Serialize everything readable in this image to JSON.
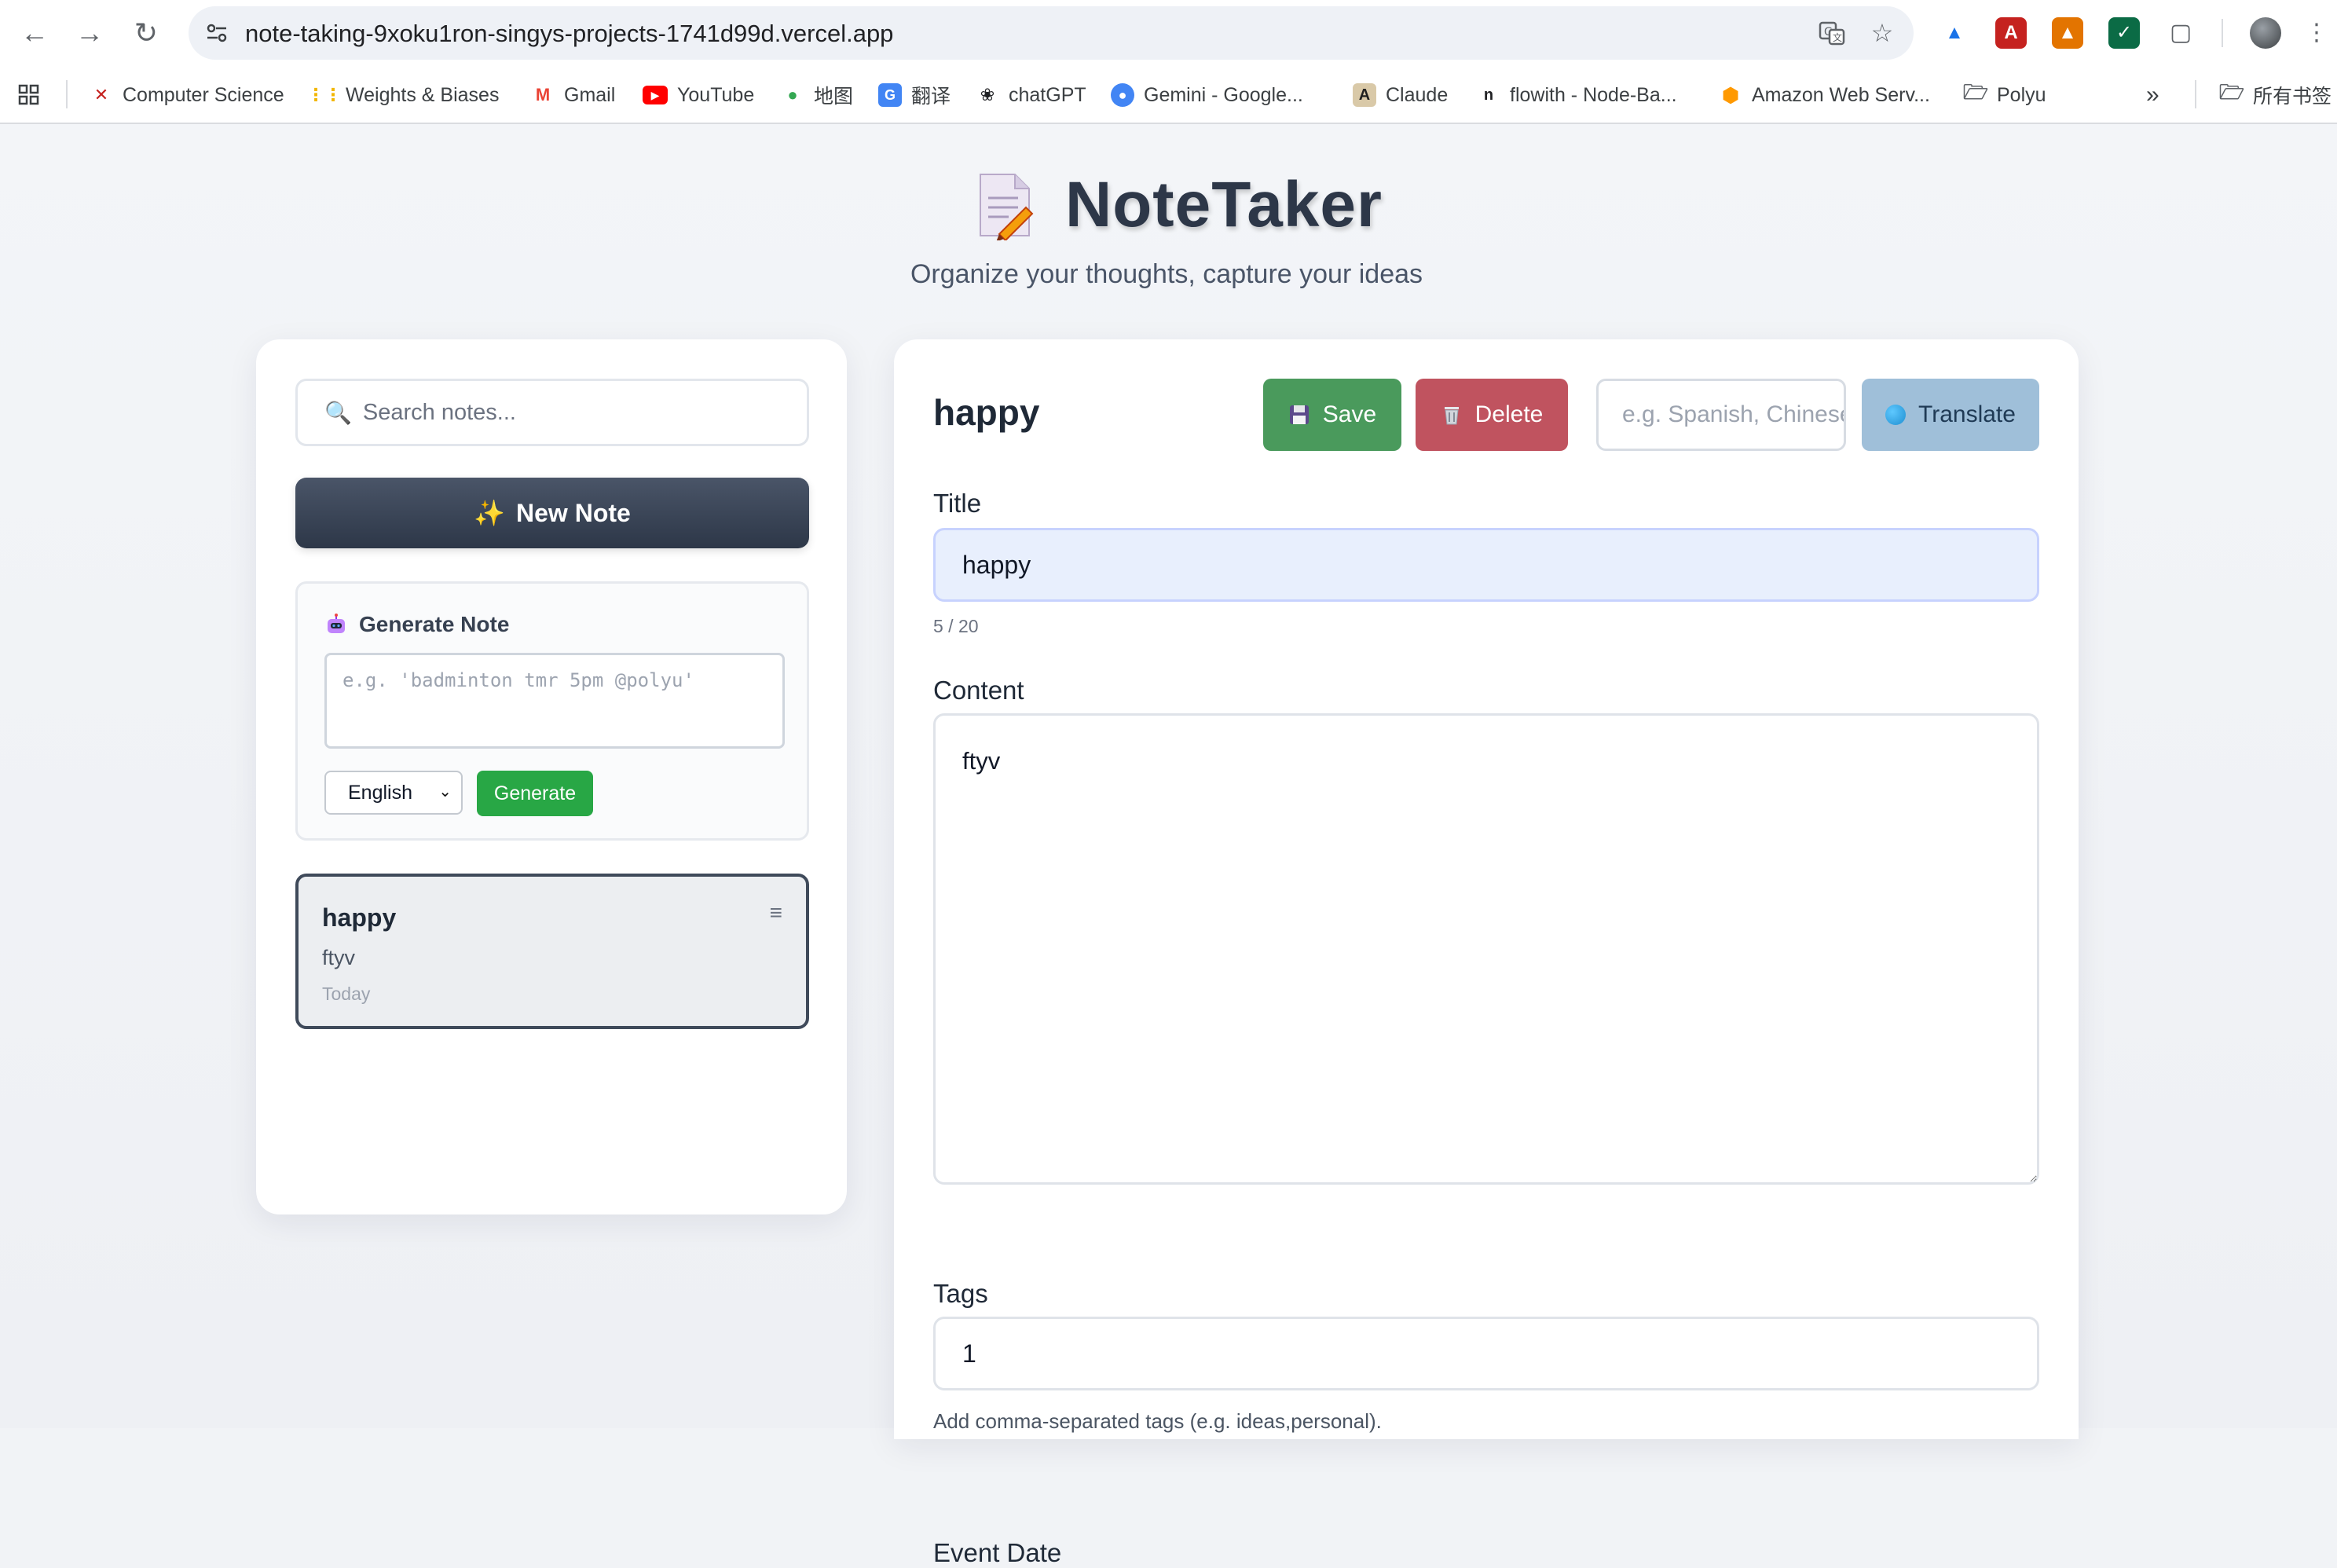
{
  "browser": {
    "url": "note-taking-9xoku1ron-singys-projects-1741d99d.vercel.app",
    "bookmarks": [
      {
        "label": "Computer Science",
        "icon": "x-logo-icon"
      },
      {
        "label": "Weights & Biases",
        "icon": "wandb-icon"
      },
      {
        "label": "Gmail",
        "icon": "gmail-icon"
      },
      {
        "label": "YouTube",
        "icon": "youtube-icon"
      },
      {
        "label": "地图",
        "icon": "maps-icon"
      },
      {
        "label": "翻译",
        "icon": "translate-icon"
      },
      {
        "label": "chatGPT",
        "icon": "openai-icon"
      },
      {
        "label": "Gemini - Google...",
        "icon": "gemini-icon"
      },
      {
        "label": "Claude",
        "icon": "anthropic-icon"
      },
      {
        "label": "flowith - Node-Ba...",
        "icon": "flowith-icon"
      },
      {
        "label": "Amazon Web Serv...",
        "icon": "aws-icon"
      },
      {
        "label": "Polyu",
        "icon": "folder-icon"
      }
    ],
    "all_bookmarks": "所有书签"
  },
  "app": {
    "title": "NoteTaker",
    "subtitle": "Organize your thoughts, capture your ideas"
  },
  "sidebar": {
    "search_placeholder": "Search notes...",
    "new_note_label": "New Note",
    "generate": {
      "title": "Generate Note",
      "input_placeholder": "e.g. 'badminton tmr 5pm @polyu'",
      "language": "English",
      "button_label": "Generate"
    },
    "notes": [
      {
        "title": "happy",
        "content": "ftyv",
        "date": "Today"
      }
    ]
  },
  "editor": {
    "heading": "happy",
    "save_label": "Save",
    "delete_label": "Delete",
    "translate_placeholder": "e.g. Spanish, Chinese",
    "translate_label": "Translate",
    "title_label": "Title",
    "title_value": "happy",
    "char_count": "5 / 20",
    "content_label": "Content",
    "content_value": "ftyv",
    "tags_label": "Tags",
    "tags_value": "1",
    "tags_help": "Add comma-separated tags (e.g. ideas,personal).",
    "event_date_label": "Event Date"
  },
  "colors": {
    "save": "#4a9a5c",
    "delete": "#c0535f",
    "translate": "#9fbfd9",
    "generate": "#28a745",
    "new_note": "#2d3748"
  }
}
